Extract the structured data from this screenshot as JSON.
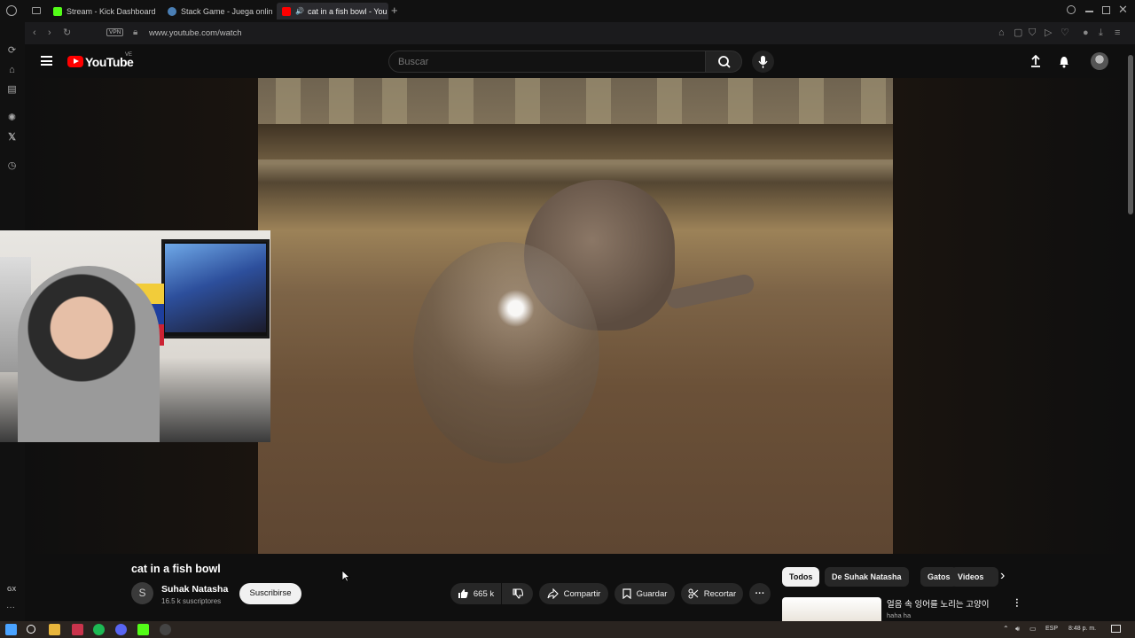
{
  "browser": {
    "tabs": [
      {
        "label": "Stream - Kick Dashboard",
        "color": "#53fc18"
      },
      {
        "label": "Stack Game - Juega onlin",
        "color": "#4a7fb5"
      },
      {
        "label": "cat in a fish bowl - You",
        "color": "#ff0000"
      }
    ],
    "url": "www.youtube.com/watch",
    "vpn_label": "VPN",
    "sidebar_label": "GX"
  },
  "youtube": {
    "logo_text": "YouTube",
    "country_code": "VE",
    "search_placeholder": "Buscar",
    "video": {
      "title": "cat in a fish bowl",
      "channel_initial": "S",
      "channel_name": "Suhak Natasha",
      "subscribers": "16.5 k suscriptores",
      "subscribe_label": "Suscribirse",
      "likes": "665 k",
      "share_label": "Compartir",
      "save_label": "Guardar",
      "clip_label": "Recortar"
    },
    "chips": [
      "Todos",
      "De Suhak Natasha",
      "Gatos",
      "Videos"
    ],
    "recommendation": {
      "title": "얼음 속 잉어를 노리는 고양이",
      "channel": "haha ha"
    }
  },
  "taskbar": {
    "language": "ESP",
    "time": "8:48 p. m."
  },
  "colors": {
    "brand_red": "#ff0000",
    "background": "#0f0f0f",
    "pill": "#272727"
  }
}
